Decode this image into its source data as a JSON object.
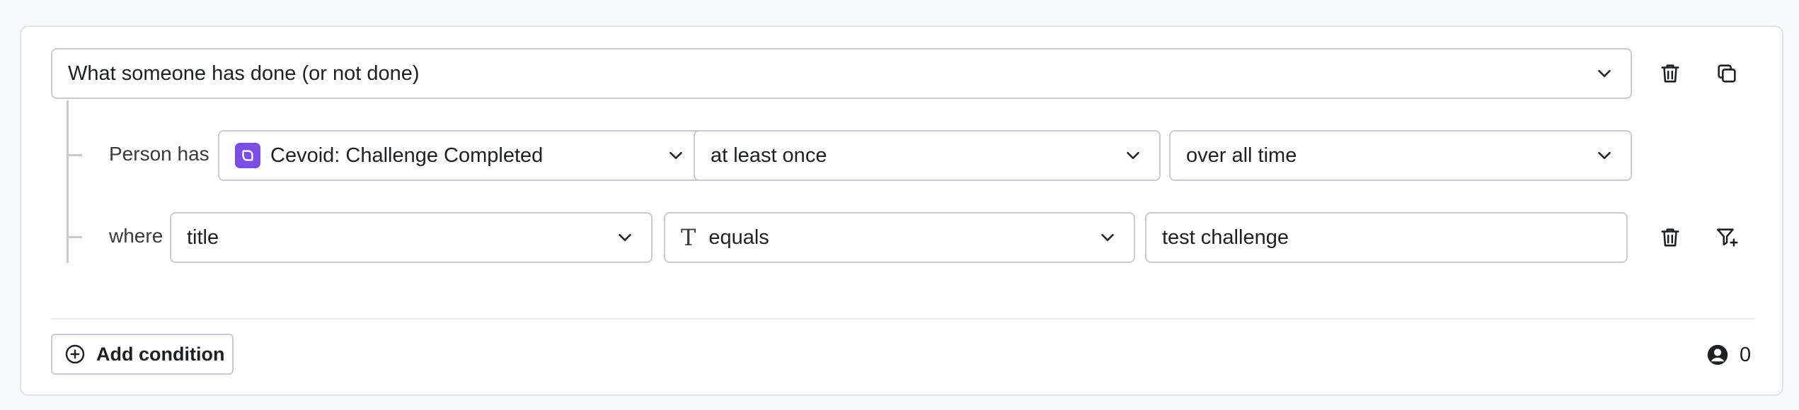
{
  "condition": {
    "type_select": {
      "value": "What someone has done (or not done)",
      "icon": "chevron-down-icon"
    },
    "actions": {
      "delete_icon": "trash-icon",
      "duplicate_icon": "copy-icon"
    }
  },
  "event_row": {
    "label": "Person has",
    "event_select": {
      "value": "Cevoid: Challenge Completed",
      "app_icon": "cevoid-logo-icon",
      "app_color": "#7b4ee6"
    },
    "frequency_select": {
      "value": "at least once"
    },
    "timeframe_select": {
      "value": "over all time"
    }
  },
  "filter_row": {
    "label": "where",
    "property_select": {
      "value": "title"
    },
    "operator_select": {
      "value": "equals",
      "type_icon": "text-type-icon"
    },
    "value_input": {
      "value": "test challenge"
    },
    "actions": {
      "delete_icon": "trash-icon",
      "add_filter_icon": "filter-plus-icon"
    }
  },
  "footer": {
    "add_condition_label": "Add condition",
    "add_icon": "plus-circle-icon",
    "profile_count": "0",
    "profile_icon": "user-circle-icon"
  },
  "colors": {
    "border": "#c9cbd1",
    "card_border": "#e3e4e8",
    "background": "#f8f9fb",
    "text": "#1f2024"
  }
}
